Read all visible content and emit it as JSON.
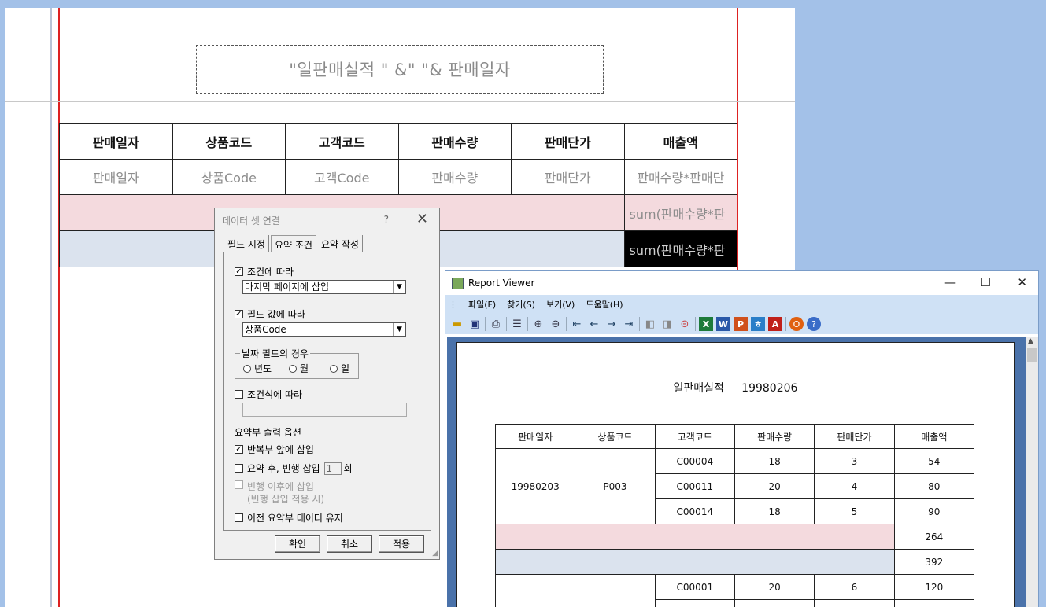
{
  "designer": {
    "title_expr": "\"일판매실적 \" &\"    \"& 판매일자",
    "headers": [
      "판매일자",
      "상품코드",
      "고객코드",
      "판매수량",
      "판매단가",
      "매출액"
    ],
    "fields": [
      "판매일자",
      "상품Code",
      "고객Code",
      "판매수량",
      "판매단가",
      "판매수량*판매단"
    ],
    "sum1": "sum(판매수량*판",
    "sum2": "sum(판매수량*판"
  },
  "dialog": {
    "title": "데이터 셋 연결",
    "help": "?",
    "tabs": [
      "필드 지정",
      "요약 조건",
      "요약 작성"
    ],
    "by_condition": "조건에 따라",
    "condition_select": "마지막 페이지에 삽입",
    "by_field": "필드 값에 따라",
    "field_select": "상품Code",
    "date_group": "날짜 필드의 경우",
    "date_options": [
      "년도",
      "월",
      "일"
    ],
    "by_expr": "조건식에 따라",
    "options_label": "요약부 출력 옵션",
    "opt_repeat": "반복부 앞에 삽입",
    "opt_blank": "요약 후, 빈행 삽입",
    "blank_count": "1",
    "blank_unit": "회",
    "opt_after_blank": "빈행 이후에 삽입",
    "opt_after_blank_note": "(빈행 삽입 적용 시)",
    "opt_keep": "이전 요약부 데이터 유지",
    "ok": "확인",
    "cancel": "취소",
    "apply": "적용"
  },
  "viewer": {
    "title": "Report Viewer",
    "menu": [
      "파일(F)",
      "찾기(S)",
      "보기(V)",
      "도움말(H)"
    ],
    "report_title": "일판매실적     19980206",
    "headers": [
      "판매일자",
      "상품코드",
      "고객코드",
      "판매수량",
      "판매단가",
      "매출액"
    ],
    "group1": {
      "date": "19980203",
      "product": "P003",
      "rows": [
        [
          "C00004",
          "18",
          "3",
          "54"
        ],
        [
          "C00011",
          "20",
          "4",
          "80"
        ],
        [
          "C00014",
          "18",
          "5",
          "90"
        ]
      ]
    },
    "sum_pink": "264",
    "sum_blue": "392",
    "row_next": [
      "C00001",
      "20",
      "6",
      "120"
    ]
  }
}
